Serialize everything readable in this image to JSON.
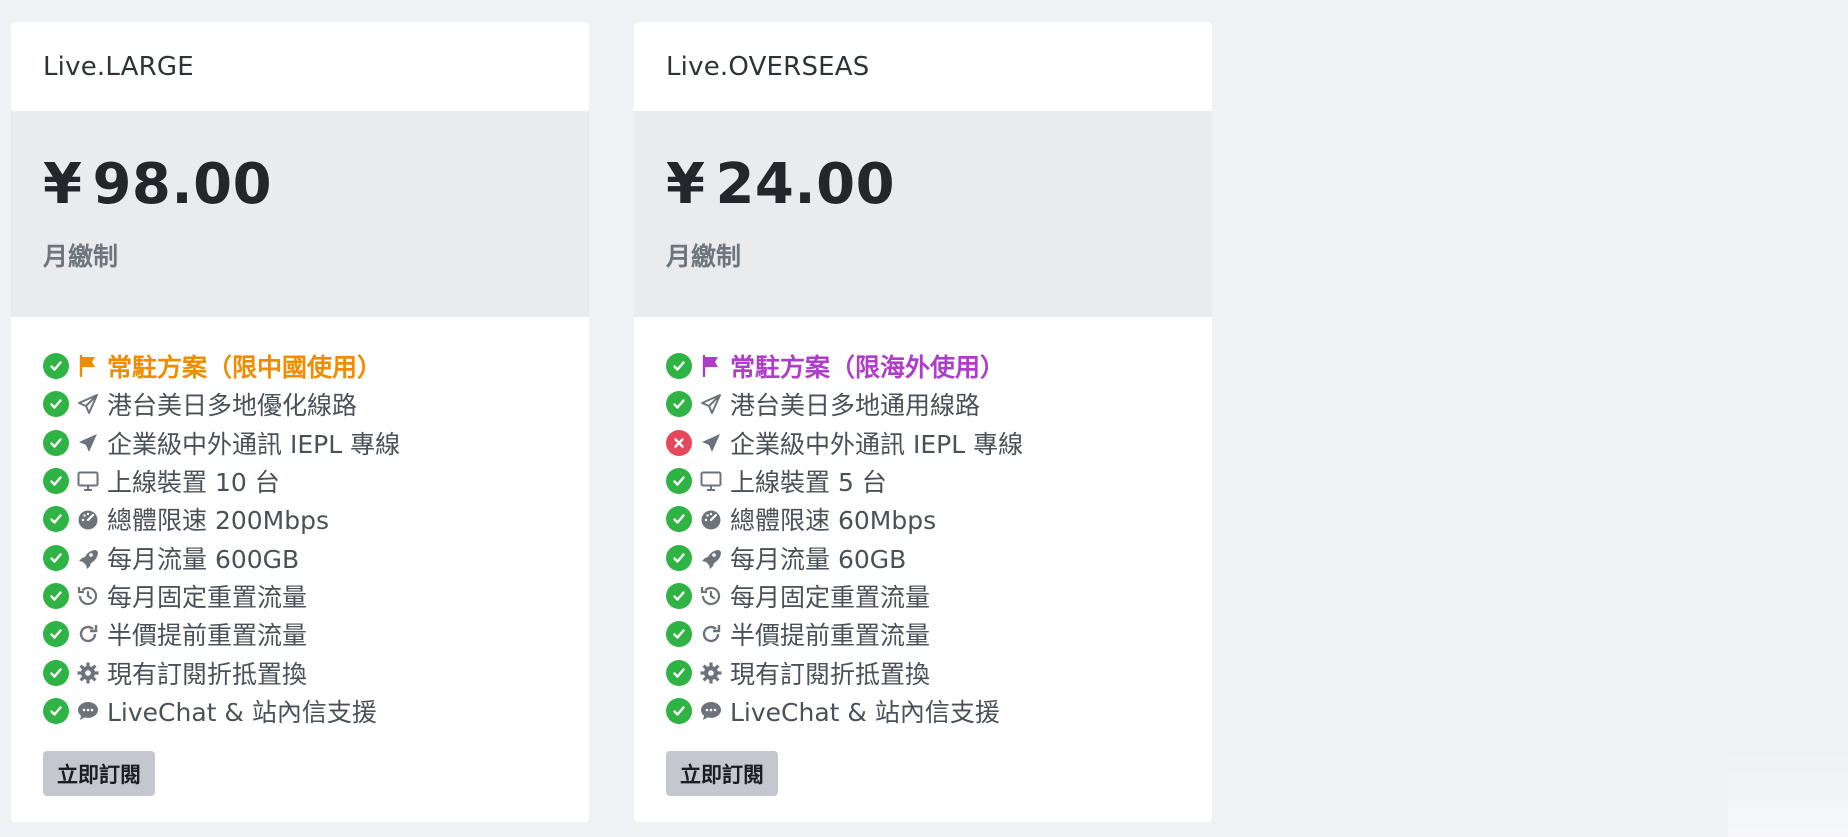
{
  "plans": [
    {
      "name": "Live.LARGE",
      "currency": "¥",
      "price": "98.00",
      "cycle": "月繳制",
      "button_label": "立即訂閱",
      "features": [
        {
          "status": "ok",
          "icon": "flag-icon",
          "text": "常駐方案（限中國使用）",
          "highlight_color": "#f08c00"
        },
        {
          "status": "ok",
          "icon": "paper-plane-outline-icon",
          "text": "港台美日多地優化線路"
        },
        {
          "status": "ok",
          "icon": "paper-plane-icon",
          "text": "企業級中外通訊 IEPL 專線"
        },
        {
          "status": "ok",
          "icon": "desktop-icon",
          "text": "上線裝置 10 台"
        },
        {
          "status": "ok",
          "icon": "speedometer-icon",
          "text": "總體限速 200Mbps"
        },
        {
          "status": "ok",
          "icon": "rocket-icon",
          "text": "每月流量 600GB"
        },
        {
          "status": "ok",
          "icon": "history-icon",
          "text": "每月固定重置流量"
        },
        {
          "status": "ok",
          "icon": "redo-icon",
          "text": "半價提前重置流量"
        },
        {
          "status": "ok",
          "icon": "gear-icon",
          "text": "現有訂閱折抵置換"
        },
        {
          "status": "ok",
          "icon": "chat-icon",
          "text": "LiveChat & 站內信支援"
        }
      ]
    },
    {
      "name": "Live.OVERSEAS",
      "currency": "¥",
      "price": "24.00",
      "cycle": "月繳制",
      "button_label": "立即訂閱",
      "features": [
        {
          "status": "ok",
          "icon": "flag-icon",
          "text": "常駐方案（限海外使用）",
          "highlight_color": "#ae3ec9"
        },
        {
          "status": "ok",
          "icon": "paper-plane-outline-icon",
          "text": "港台美日多地通用線路"
        },
        {
          "status": "no",
          "icon": "paper-plane-icon",
          "text": "企業級中外通訊 IEPL 專線"
        },
        {
          "status": "ok",
          "icon": "desktop-icon",
          "text": "上線裝置 5 台"
        },
        {
          "status": "ok",
          "icon": "speedometer-icon",
          "text": "總體限速 60Mbps"
        },
        {
          "status": "ok",
          "icon": "rocket-icon",
          "text": "每月流量 60GB"
        },
        {
          "status": "ok",
          "icon": "history-icon",
          "text": "每月固定重置流量"
        },
        {
          "status": "ok",
          "icon": "redo-icon",
          "text": "半價提前重置流量"
        },
        {
          "status": "ok",
          "icon": "gear-icon",
          "text": "現有訂閱折抵置換"
        },
        {
          "status": "ok",
          "icon": "chat-icon",
          "text": "LiveChat & 站內信支援"
        }
      ]
    }
  ],
  "colors": {
    "ok": "#2fb344",
    "no": "#e5485d",
    "icon": "#6c737a",
    "page_background": "#f0f1f5",
    "price_background": "#eaebef",
    "button_background": "#c4c7cd"
  }
}
